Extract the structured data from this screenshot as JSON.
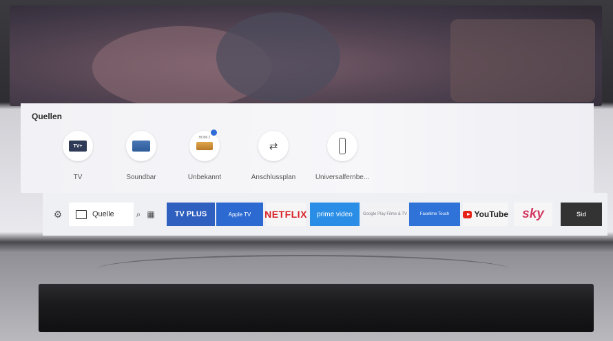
{
  "panel": {
    "title": "Quellen",
    "sources": [
      {
        "label": "TV",
        "icon": "tv-icon"
      },
      {
        "label": "Soundbar",
        "icon": "soundbar-icon"
      },
      {
        "label": "Unbekannt",
        "icon": "hdmi-icon",
        "tag": "HDMI 2"
      },
      {
        "label": "Anschlussplan",
        "icon": "connection-plan-icon"
      },
      {
        "label": "Universalfernbe...",
        "icon": "remote-icon"
      }
    ]
  },
  "dock": {
    "settings_icon": "gear-icon",
    "source_label": "Quelle",
    "search_icon": "search-icon",
    "apps_icon": "apps-grid-icon",
    "apps": [
      {
        "label": "TV PLUS"
      },
      {
        "label": "Apple TV"
      },
      {
        "label": "NETFLIX"
      },
      {
        "label": "prime video"
      },
      {
        "label": "Google Play Filme & TV"
      },
      {
        "label": "Facetime Touch"
      },
      {
        "label": "YouTube"
      },
      {
        "label": "sky"
      },
      {
        "label": "Sid"
      }
    ]
  },
  "colors": {
    "accent_blue": "#2c6ad2",
    "netflix_red": "#d81f26",
    "youtube_red": "#e62117",
    "sky_pink": "#d33a63"
  }
}
